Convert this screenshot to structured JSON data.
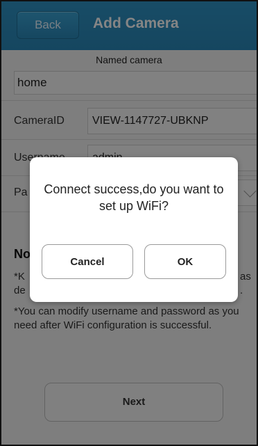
{
  "header": {
    "back_label": "Back",
    "title": "Add Camera"
  },
  "form": {
    "section_label": "Named camera",
    "camera_name_value": "home",
    "camera_id_label": "CameraID",
    "camera_id_value": "VIEW-1147727-UBKNP",
    "username_label": "Username",
    "username_value": "admin",
    "password_label": "Pa"
  },
  "notes": {
    "title": "No",
    "line1_left": "*K",
    "line1_right": "as",
    "line2_left": "de",
    "line2_right": ".",
    "line3": "*You can modify username and password as you need after WiFi configuration is successful."
  },
  "next_label": "Next",
  "dialog": {
    "message": "Connect success,do you want to set up WiFi?",
    "cancel_label": "Cancel",
    "ok_label": "OK"
  },
  "colors": {
    "header": "#2a87b8",
    "overlay": "rgba(0,0,0,0.48)"
  }
}
